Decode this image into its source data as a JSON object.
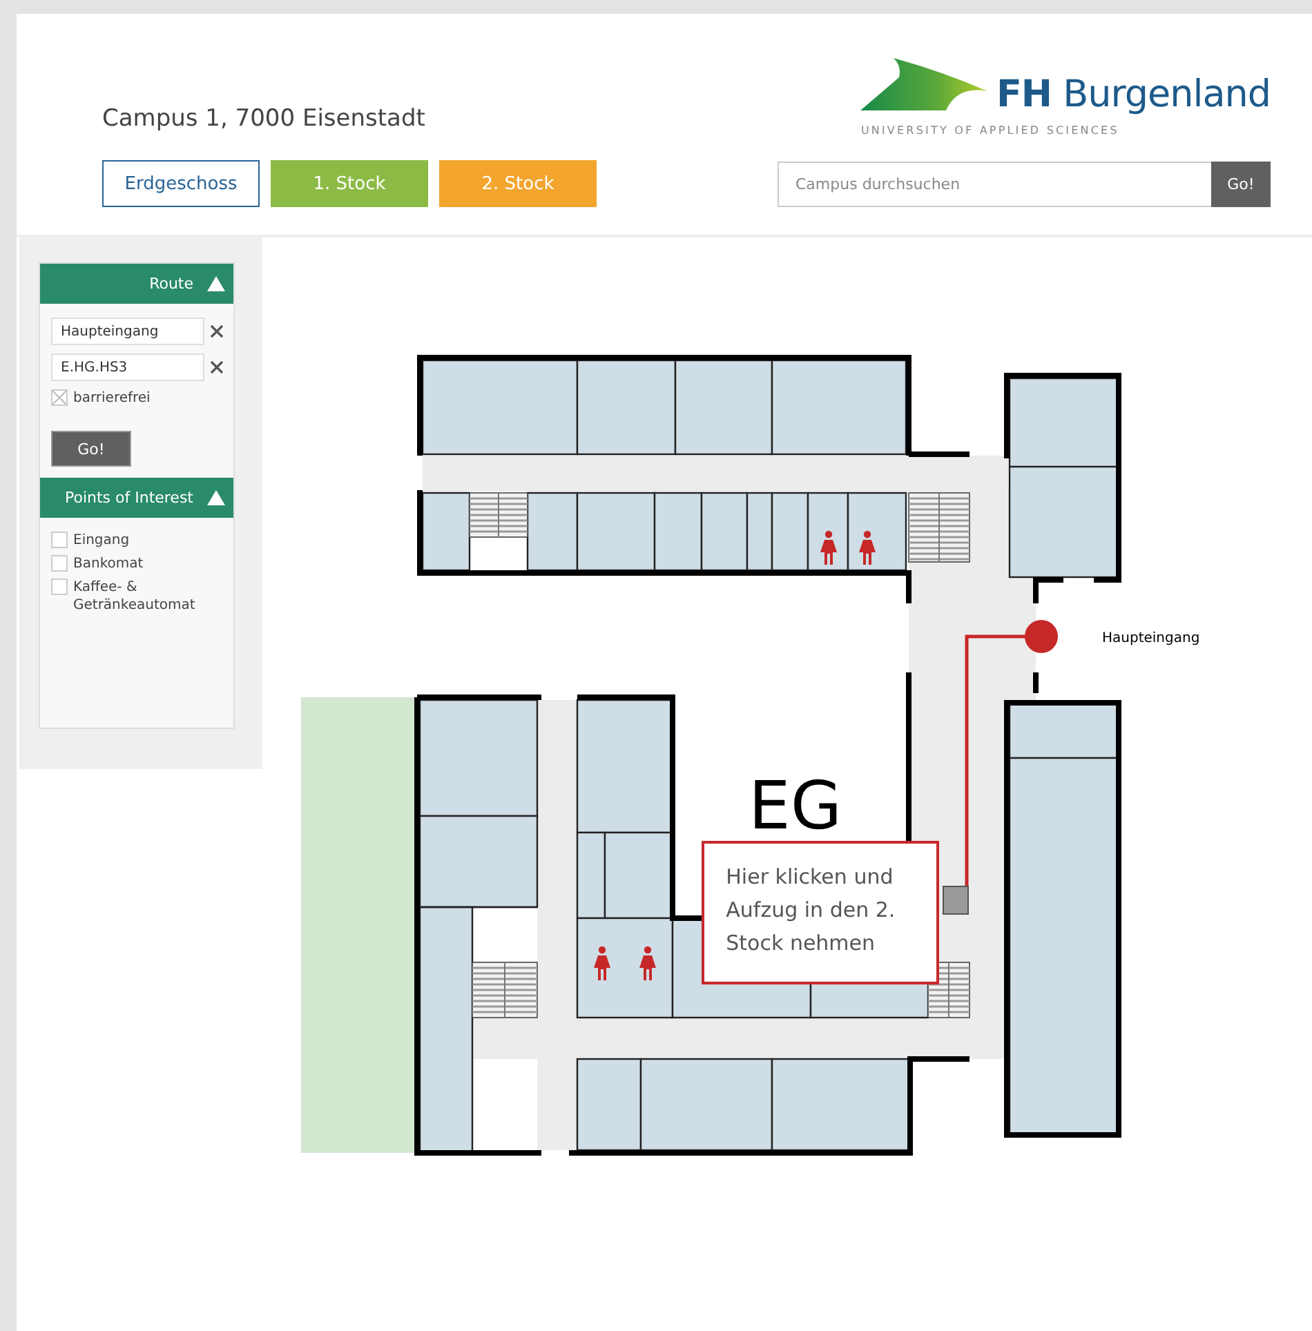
{
  "header": {
    "title": "Campus 1, 7000 Eisenstadt",
    "logo": {
      "text": "**FH** Burgenland",
      "tagline": "UNIVERSITY OF APPLIED SCIENCES"
    },
    "floor_tabs": [
      {
        "label": "Erdgeschoss",
        "selected": true,
        "color": "#2a6496"
      },
      {
        "label": "1. Stock",
        "selected": false,
        "color": "#8cbb45"
      },
      {
        "label": "2. Stock",
        "selected": false,
        "color": "#f3a52e"
      }
    ],
    "search": {
      "placeholder": "Campus durchsuchen",
      "button": "Go!"
    }
  },
  "sidebar": {
    "route": {
      "title": "Route",
      "expanded": true,
      "from": "Haupteingang",
      "to": "E.HG.HS3",
      "barrier_free": {
        "label": "barrierefrei",
        "checked": true
      },
      "button": "Go!"
    },
    "points_of_interest": {
      "title": "Points of Interest",
      "expanded": true,
      "items": [
        {
          "label": "Eingang",
          "checked": false
        },
        {
          "label": "Bankomat",
          "checked": false
        },
        {
          "label": "Kaffee- & Getränkeautomat",
          "checked": false
        }
      ]
    }
  },
  "map": {
    "floor_label": "EG",
    "entrance_label": "Haupteingang",
    "callout": "Hier klicken und Aufzug in den 2. Stock nehmen"
  }
}
